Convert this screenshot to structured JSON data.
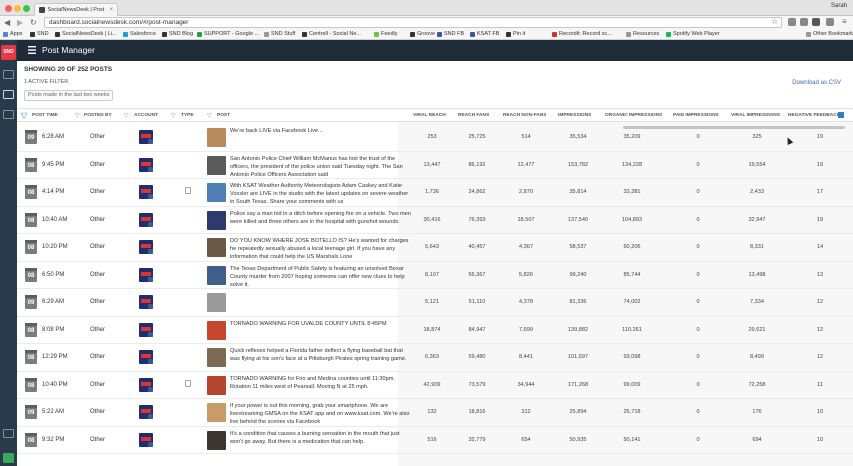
{
  "browser": {
    "tab_title": "SocialNewsDesk | Post Ma",
    "tab_close": "×",
    "user": "Sarah",
    "url": "dashboard.socialnewsdesk.com/#/post-manager",
    "bookmarks": [
      {
        "label": "Apps",
        "color": "#5a7fd6"
      },
      {
        "label": "SND",
        "color": "#333"
      },
      {
        "label": "SocialNewsDesk | Li...",
        "color": "#333"
      },
      {
        "label": "Salesforce",
        "color": "#1ea0d8"
      },
      {
        "label": "SND Blog",
        "color": "#333"
      },
      {
        "label": "SUPPORT - Google ...",
        "color": "#2a9d4c"
      },
      {
        "label": "SND Stuff",
        "color": "#999"
      },
      {
        "label": "Centrell - Social Ne...",
        "color": "#333"
      },
      {
        "label": "Feedly",
        "color": "#6cc04a"
      },
      {
        "label": "Groove",
        "color": "#333"
      },
      {
        "label": "SND FB",
        "color": "#3b5998"
      },
      {
        "label": "KSAT FB",
        "color": "#3b5998"
      },
      {
        "label": "Pin it",
        "color": "#333"
      },
      {
        "label": "Recordit: Record sc...",
        "color": "#c33"
      },
      {
        "label": "Resources",
        "color": "#999"
      },
      {
        "label": "Spotify Web Player",
        "color": "#1db954"
      },
      {
        "label": "Other Bookmarks",
        "color": "#999"
      }
    ]
  },
  "app": {
    "logo": "SND",
    "title": "Post Manager",
    "showing": "SHOWING 20 OF 252 POSTS",
    "active_filter": "1 ACTIVE FILTER",
    "filter_pill": "Posts made in the last two weeks",
    "download": "Download as CSV"
  },
  "table": {
    "headers": {
      "post_time": "POST TIME",
      "posted_by": "POSTED BY",
      "account": "ACCOUNT",
      "type": "TYPE",
      "post": "POST",
      "viral_reach": "VIRAL REACH",
      "reach_fans": "REACH FANS",
      "reach_non_fans": "REACH NON-FANS",
      "impressions": "IMPRESSIONS",
      "organic_impressions": "ORGANIC IMPRESSIONS",
      "paid_impressions": "PAID IMPRESSIONS",
      "viral_impressions": "VIRAL IMPRESSIONS",
      "negative_feedback": "NEGATIVE FEEDBACK"
    },
    "rows": [
      {
        "day": "09",
        "time": "6:28 AM",
        "posted_by": "Other",
        "has_type": false,
        "thumb": "#b98a5e",
        "text": "We're back LIVE via Facebook Live...",
        "viral_reach": "253",
        "reach_fans": "25,725",
        "reach_non_fans": "514",
        "impressions": "35,534",
        "organic": "35,209",
        "paid": "0",
        "viral_imp": "325",
        "neg": "19"
      },
      {
        "day": "08",
        "time": "9:45 PM",
        "posted_by": "Other",
        "has_type": false,
        "thumb": "#5a5a5a",
        "text": "San Antonio Police Chief William McManus has lost the trust of the officers, the president of the police union said Tuesday night. The San Antonio Police Officers Association said",
        "viral_reach": "13,447",
        "reach_fans": "86,192",
        "reach_non_fans": "12,477",
        "impressions": "153,782",
        "organic": "134,228",
        "paid": "0",
        "viral_imp": "19,554",
        "neg": "19"
      },
      {
        "day": "08",
        "time": "4:14 PM",
        "posted_by": "Other",
        "has_type": true,
        "thumb": "#4f7fb5",
        "text": "With KSAT Weather Authority Meteorologists Adam Caskey and Katie Vossler are LIVE in the studio with the latest updates on severe weather in South Texas. Share your comments with us",
        "viral_reach": "1,736",
        "reach_fans": "24,862",
        "reach_non_fans": "2,870",
        "impressions": "35,814",
        "organic": "33,381",
        "paid": "0",
        "viral_imp": "2,433",
        "neg": "17"
      },
      {
        "day": "08",
        "time": "10:40 AM",
        "posted_by": "Other",
        "has_type": false,
        "thumb": "#2c3a6e",
        "text": "Police say a man hid in a ditch before opening fire on a vehicle. Two men were killed and three others are in the hospital with gunshot wounds.",
        "viral_reach": "30,416",
        "reach_fans": "76,393",
        "reach_non_fans": "18,507",
        "impressions": "137,540",
        "organic": "104,893",
        "paid": "0",
        "viral_imp": "32,947",
        "neg": "19"
      },
      {
        "day": "08",
        "time": "10:20 PM",
        "posted_by": "Other",
        "has_type": false,
        "thumb": "#6b5a48",
        "text": "DO YOU KNOW WHERE JOSE BOTELLO IS? He's wanted for charges he repeatedly sexually abused a local teenage girl. If you have any information that could help the US Marshals Lone",
        "viral_reach": "5,643",
        "reach_fans": "40,457",
        "reach_non_fans": "4,367",
        "impressions": "58,537",
        "organic": "60,206",
        "paid": "0",
        "viral_imp": "8,331",
        "neg": "14"
      },
      {
        "day": "08",
        "time": "6:50 PM",
        "posted_by": "Other",
        "has_type": false,
        "thumb": "#3f5f8a",
        "text": "The Texas Department of Public Safety is featuring an unsolved Bexar County murder from 2007 hoping someone can offer new clues to help solve it.",
        "viral_reach": "8,107",
        "reach_fans": "56,367",
        "reach_non_fans": "5,826",
        "impressions": "99,240",
        "organic": "85,744",
        "paid": "0",
        "viral_imp": "13,498",
        "neg": "13"
      },
      {
        "day": "09",
        "time": "6:29 AM",
        "posted_by": "Other",
        "has_type": false,
        "thumb": "#9a9a9a",
        "text": "",
        "viral_reach": "5,121",
        "reach_fans": "51,110",
        "reach_non_fans": "4,378",
        "impressions": "81,336",
        "organic": "74,002",
        "paid": "0",
        "viral_imp": "7,334",
        "neg": "12"
      },
      {
        "day": "08",
        "time": "8:08 PM",
        "posted_by": "Other",
        "has_type": false,
        "thumb": "#c6462e",
        "text": "TORNADO WARNING FOR UVALDE COUNTY UNTIL 8:45PM",
        "viral_reach": "18,874",
        "reach_fans": "84,947",
        "reach_non_fans": "7,699",
        "impressions": "139,882",
        "organic": "110,261",
        "paid": "0",
        "viral_imp": "29,621",
        "neg": "12"
      },
      {
        "day": "08",
        "time": "12:29 PM",
        "posted_by": "Other",
        "has_type": false,
        "thumb": "#7b6a55",
        "text": "Quick reflexes helped a Florida father deflect a flying baseball bat that was flying at his son's face at a Pittsburgh Pirates spring training game.",
        "viral_reach": "6,363",
        "reach_fans": "59,480",
        "reach_non_fans": "8,441",
        "impressions": "101,597",
        "organic": "93,098",
        "paid": "0",
        "viral_imp": "8,499",
        "neg": "12"
      },
      {
        "day": "08",
        "time": "10:40 PM",
        "posted_by": "Other",
        "has_type": true,
        "thumb": "#b4462e",
        "text": "TORNADO WARNING for Frio and Medina counties until 11:30pm. Rotation 11 miles west of Pearsall. Moving N at 25 mph.",
        "viral_reach": "42,909",
        "reach_fans": "73,579",
        "reach_non_fans": "34,944",
        "impressions": "171,268",
        "organic": "99,009",
        "paid": "0",
        "viral_imp": "72,258",
        "neg": "11"
      },
      {
        "day": "09",
        "time": "5:22 AM",
        "posted_by": "Other",
        "has_type": false,
        "thumb": "#c99a6a",
        "text": "If your power is out this morning, grab your smartphone. We are livestreaming GMSA on the KSAT app and on www.ksat.com. We're also live behind the scenes via Facebook",
        "viral_reach": "132",
        "reach_fans": "18,816",
        "reach_non_fans": "312",
        "impressions": "25,894",
        "organic": "25,718",
        "paid": "0",
        "viral_imp": "176",
        "neg": "10"
      },
      {
        "day": "08",
        "time": "9:32 PM",
        "posted_by": "Other",
        "has_type": false,
        "thumb": "#3c3530",
        "text": "It's a condition that causes a burning sensation in the mouth that just won't go away. But there is a medication that can help.",
        "viral_reach": "516",
        "reach_fans": "32,779",
        "reach_non_fans": "654",
        "impressions": "50,935",
        "organic": "50,141",
        "paid": "0",
        "viral_imp": "694",
        "neg": "10"
      }
    ]
  }
}
